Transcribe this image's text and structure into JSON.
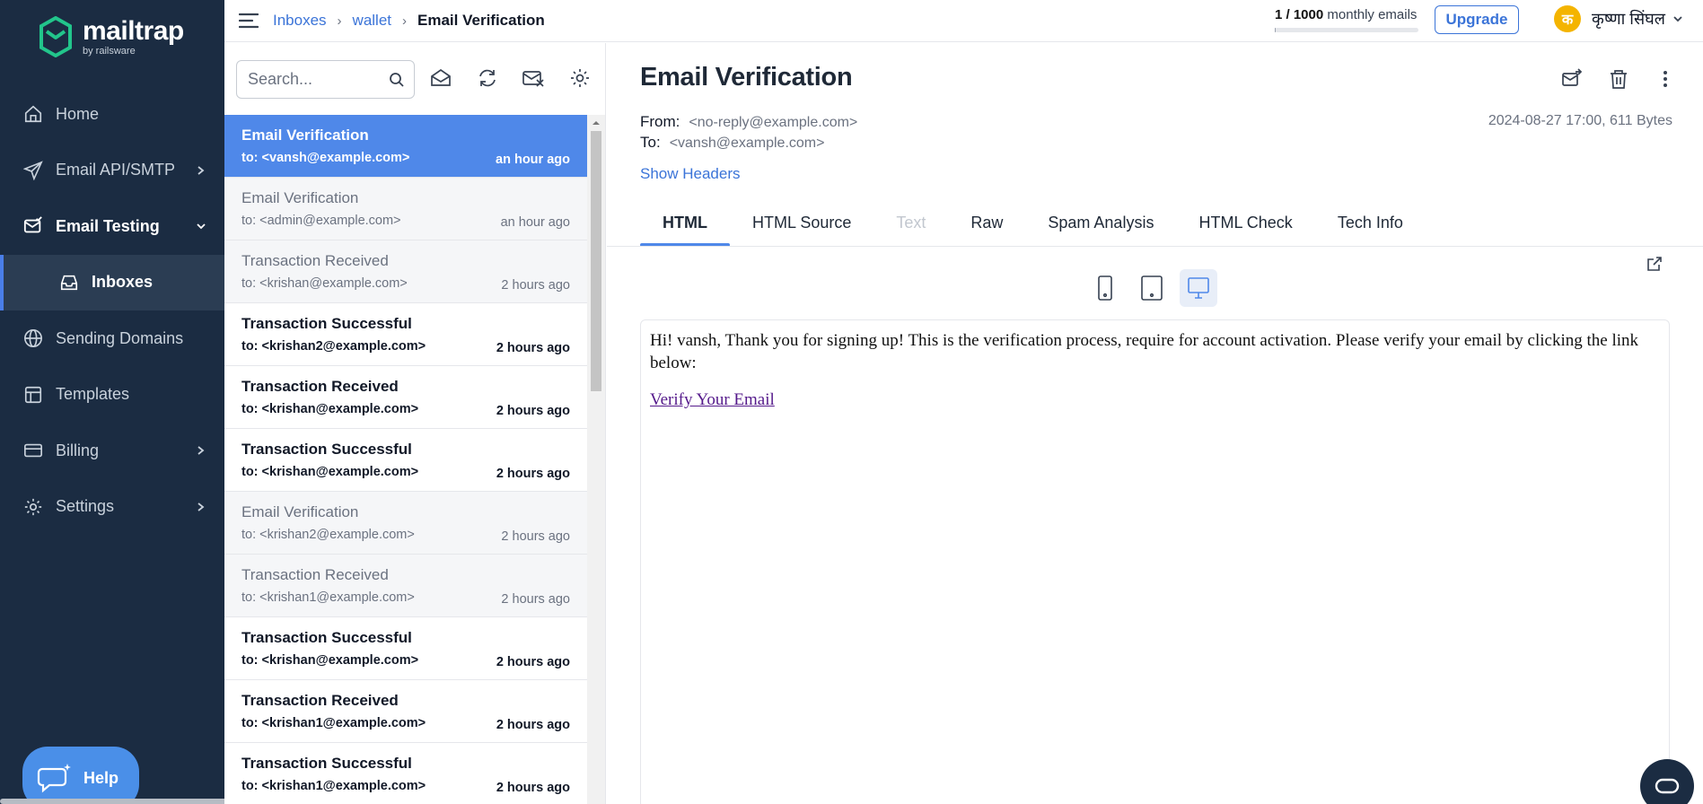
{
  "brand": {
    "name": "mailtrap",
    "sub": "by railsware",
    "accent": "#4f88e9",
    "sidebar_bg": "#1b2c42",
    "logo_color": "#22c58b"
  },
  "sidebar": {
    "items": [
      {
        "label": "Home",
        "icon": "home-icon"
      },
      {
        "label": "Email API/SMTP",
        "icon": "send-icon"
      },
      {
        "label": "Email Testing",
        "icon": "mail-check-icon"
      },
      {
        "label": "Inboxes",
        "icon": "inbox-icon"
      },
      {
        "label": "Sending Domains",
        "icon": "globe-icon"
      },
      {
        "label": "Templates",
        "icon": "template-icon"
      },
      {
        "label": "Billing",
        "icon": "card-icon"
      },
      {
        "label": "Settings",
        "icon": "gear-icon"
      }
    ],
    "help": "Help"
  },
  "topbar": {
    "breadcrumb": [
      "Inboxes",
      "wallet",
      "Email Verification"
    ],
    "quota_used": "1 / 1000",
    "quota_suffix": "monthly emails",
    "quota_fraction": 0.001,
    "upgrade": "Upgrade",
    "user_initial": "क",
    "user_name": "कृष्णा सिंघल"
  },
  "list": {
    "search_placeholder": "Search...",
    "messages": [
      {
        "subject": "Email Verification",
        "to": "to: <vansh@example.com>",
        "time": "an hour ago",
        "state": "active"
      },
      {
        "subject": "Email Verification",
        "to": "to: <admin@example.com>",
        "time": "an hour ago",
        "state": "read"
      },
      {
        "subject": "Transaction Received",
        "to": "to: <krishan@example.com>",
        "time": "2 hours ago",
        "state": "read"
      },
      {
        "subject": "Transaction Successful",
        "to": "to: <krishan2@example.com>",
        "time": "2 hours ago",
        "state": "unread"
      },
      {
        "subject": "Transaction Received",
        "to": "to: <krishan@example.com>",
        "time": "2 hours ago",
        "state": "unread"
      },
      {
        "subject": "Transaction Successful",
        "to": "to: <krishan@example.com>",
        "time": "2 hours ago",
        "state": "unread"
      },
      {
        "subject": "Email Verification",
        "to": "to: <krishan2@example.com>",
        "time": "2 hours ago",
        "state": "read"
      },
      {
        "subject": "Transaction Received",
        "to": "to: <krishan1@example.com>",
        "time": "2 hours ago",
        "state": "read"
      },
      {
        "subject": "Transaction Successful",
        "to": "to: <krishan@example.com>",
        "time": "2 hours ago",
        "state": "unread"
      },
      {
        "subject": "Transaction Received",
        "to": "to: <krishan1@example.com>",
        "time": "2 hours ago",
        "state": "unread"
      },
      {
        "subject": "Transaction Successful",
        "to": "to: <krishan1@example.com>",
        "time": "2 hours ago",
        "state": "unread"
      }
    ]
  },
  "detail": {
    "title": "Email Verification",
    "from_label": "From:",
    "from": "<no-reply@example.com>",
    "to_label": "To:",
    "to": "<vansh@example.com>",
    "meta": "2024-08-27 17:00, 611 Bytes",
    "show_headers": "Show Headers",
    "tabs": [
      "HTML",
      "HTML Source",
      "Text",
      "Raw",
      "Spam Analysis",
      "HTML Check",
      "Tech Info"
    ],
    "active_tab": "HTML",
    "body_text": "Hi! vansh, Thank you for signing up! This is the verification process, require for account activation. Please verify your email by clicking the link below:",
    "body_link": "Verify Your Email"
  }
}
